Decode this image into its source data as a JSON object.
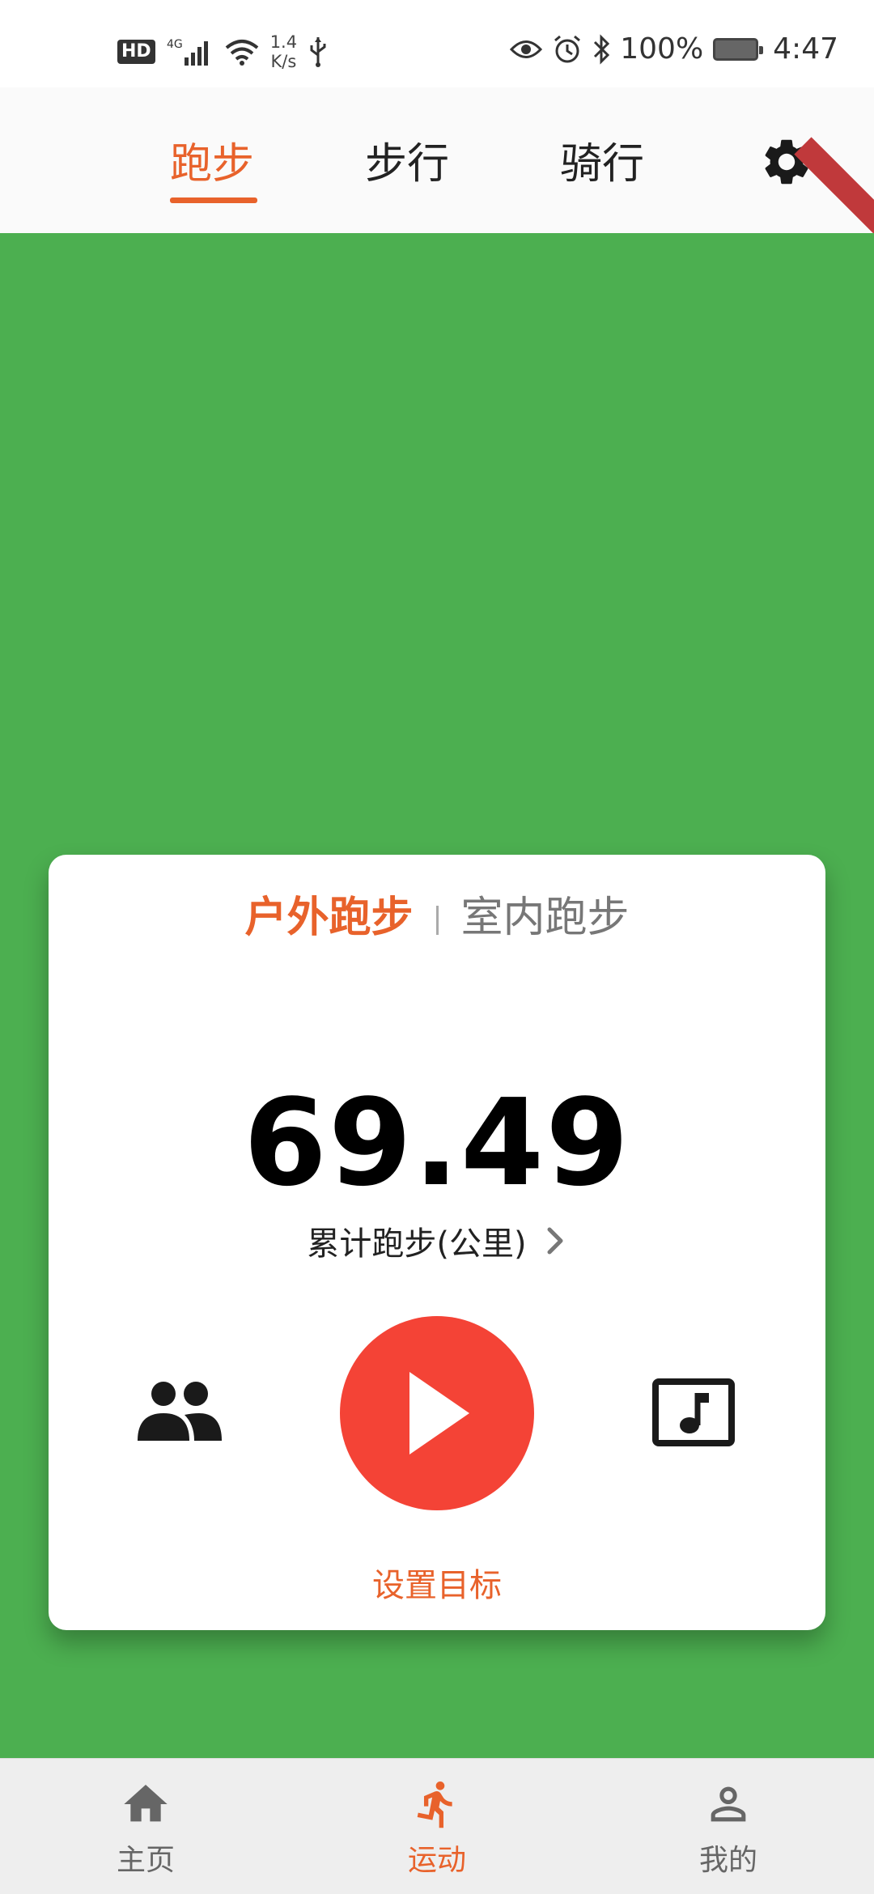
{
  "status_bar": {
    "hd": "HD",
    "net_type": "4G",
    "net_speed_value": "1.4",
    "net_speed_unit": "K/s",
    "battery": "100%",
    "time": "4:47"
  },
  "top_tabs": {
    "items": [
      {
        "label": "跑步",
        "active": true
      },
      {
        "label": "步行",
        "active": false
      },
      {
        "label": "骑行",
        "active": false
      }
    ],
    "accent_color": "#e8622b"
  },
  "map": {
    "background_color": "#4caf50"
  },
  "card": {
    "mode_outdoor": "户外跑步",
    "mode_indoor": "室内跑步",
    "distance_value": "69.49",
    "distance_label": "累计跑步(公里)",
    "set_goal": "设置目标",
    "start_color": "#f44336"
  },
  "bottom_nav": {
    "items": [
      {
        "label": "主页",
        "icon": "home-icon",
        "active": false
      },
      {
        "label": "运动",
        "icon": "running-icon",
        "active": true
      },
      {
        "label": "我的",
        "icon": "person-icon",
        "active": false
      }
    ]
  }
}
